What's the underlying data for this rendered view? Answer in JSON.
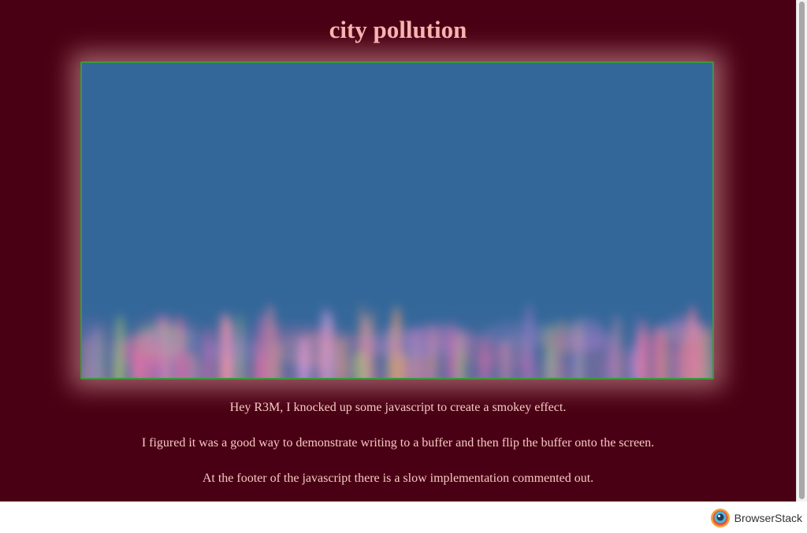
{
  "page": {
    "title": "city pollution",
    "paragraphs": [
      "Hey R3M, I knocked up some javascript to create a smokey effect.",
      "I figured it was a good way to demonstrate writing to a buffer and then flip the buffer onto the screen.",
      "At the footer of the javascript there is a slow implementation commented out."
    ]
  },
  "footer": {
    "brand": "BrowserStack",
    "logo_icon": "browserstack-logo-icon"
  },
  "colors": {
    "page_background": "#4a0014",
    "title": "#f6b4b0",
    "text": "#f6c9c4",
    "canvas_sky": "#33679a",
    "canvas_border": "#3a9a3a"
  }
}
